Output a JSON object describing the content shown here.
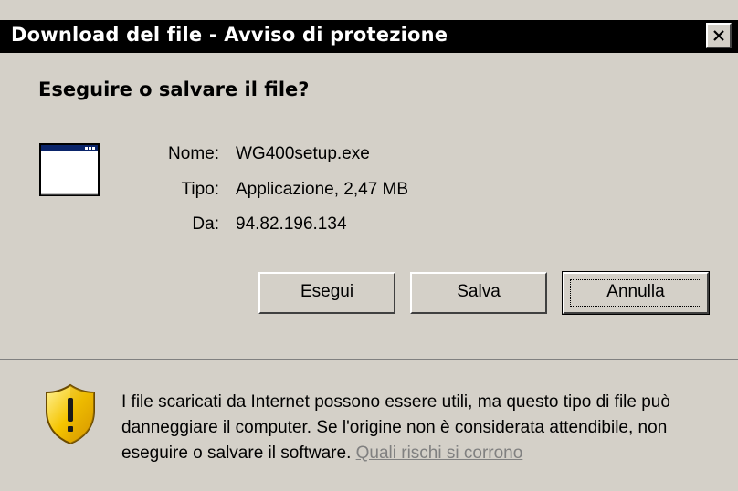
{
  "window": {
    "title": "Download del file - Avviso di protezione",
    "close_glyph": "✕"
  },
  "question": "Eseguire o salvare il file?",
  "file_info": {
    "name_label": "Nome:",
    "name_value": "WG400setup.exe",
    "type_label": "Tipo:",
    "type_value": "Applicazione, 2,47 MB",
    "from_label": "Da:",
    "from_value": "94.82.196.134"
  },
  "buttons": {
    "run": {
      "label": "Esegui",
      "accel_char": "E",
      "rest": "segui"
    },
    "save": {
      "label": "Salva",
      "pre": "Sal",
      "accel_char": "v",
      "post": "a"
    },
    "cancel": {
      "label": "Annulla"
    }
  },
  "warning": {
    "text": "I file scaricati da Internet possono essere utili, ma questo tipo di file può danneggiare il computer. Se l'origine non è considerata attendibile, non eseguire o salvare il software. ",
    "link_text": "Quali rischi si corrono"
  },
  "icons": {
    "app": "application-window-icon",
    "shield": "security-shield-warning-icon",
    "close": "close-icon"
  },
  "colors": {
    "dialog_bg": "#d4d0c8",
    "titlebar_bg": "#000000",
    "title_text": "#ffffff",
    "link": "#808080",
    "shield_yellow": "#f5c400"
  }
}
